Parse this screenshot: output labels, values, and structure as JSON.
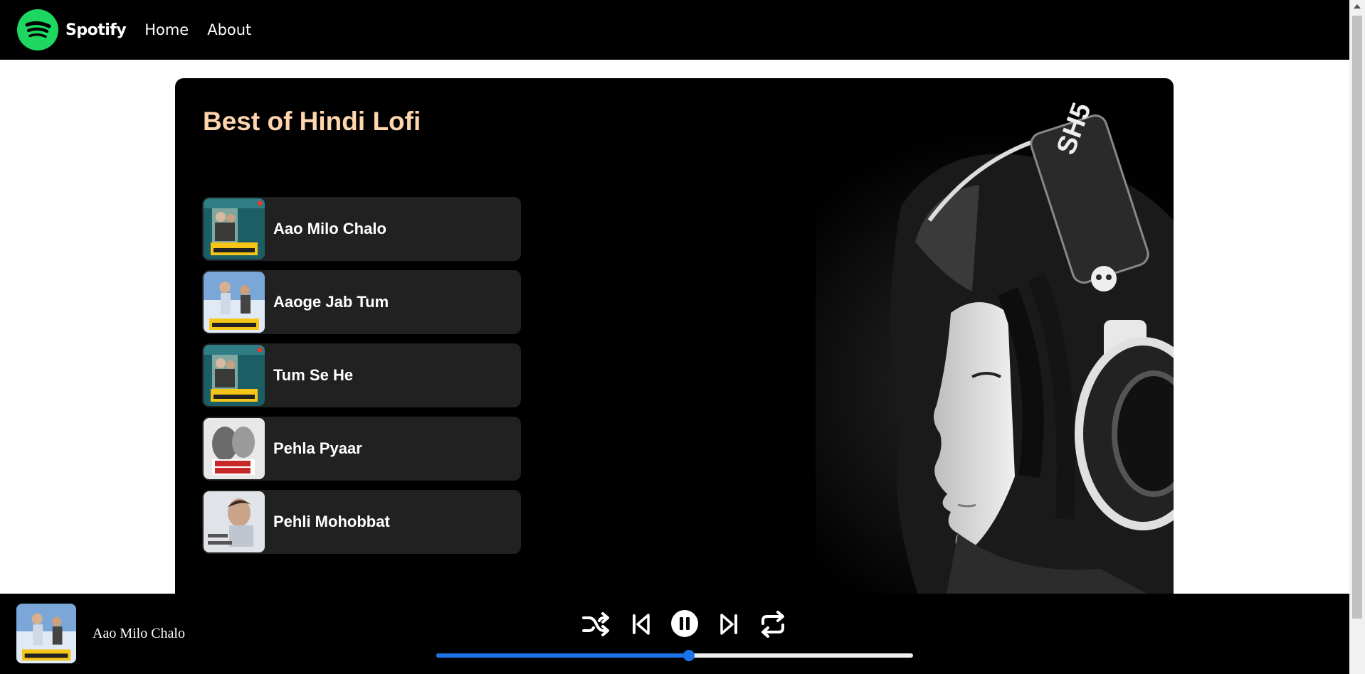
{
  "nav": {
    "brand": "Spotify",
    "links": [
      "Home",
      "About"
    ]
  },
  "playlist": {
    "title": "Best of Hindi Lofi",
    "songs": [
      {
        "name": "Aao Milo Chalo",
        "cover": "jab-we-met-cover-a"
      },
      {
        "name": "Aaoge Jab Tum",
        "cover": "jab-we-met-cover-b"
      },
      {
        "name": "Tum Se He",
        "cover": "jab-we-met-cover-a"
      },
      {
        "name": "Pehla Pyaar",
        "cover": "kabir-singh-cover"
      },
      {
        "name": "Pehli Mohobbat",
        "cover": "pehli-mohobbat-cover"
      }
    ]
  },
  "player": {
    "now_playing": "Aao Milo Chalo",
    "progress": 0.53,
    "controls": [
      "shuffle-icon",
      "previous-icon",
      "pause-icon",
      "next-icon",
      "repeat-icon"
    ]
  },
  "colors": {
    "brand_green": "#1ed760",
    "title_color": "#ffd5ad",
    "song_bg": "#212121",
    "progress_blue": "#1a73e8"
  }
}
